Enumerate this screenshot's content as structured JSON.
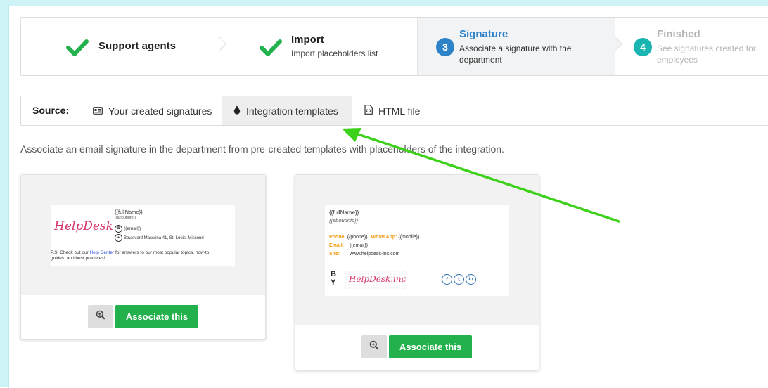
{
  "steps": [
    {
      "title": "Support agents",
      "subtitle": "",
      "state": "done"
    },
    {
      "title": "Import",
      "subtitle": "Import placeholders list",
      "state": "done"
    },
    {
      "title": "Signature",
      "subtitle_line1": "Associate a signature with the",
      "subtitle_line2": "department",
      "number": "3",
      "state": "active"
    },
    {
      "title": "Finished",
      "subtitle_line1": "See signatures created for",
      "subtitle_line2": "employees",
      "number": "4",
      "state": "pending"
    }
  ],
  "source": {
    "label": "Source:",
    "tabs": [
      {
        "label": "Your created signatures",
        "icon": "id-card-icon"
      },
      {
        "label": "Integration templates",
        "icon": "drop-icon",
        "active": true
      },
      {
        "label": "HTML file",
        "icon": "code-file-icon"
      }
    ]
  },
  "description": "Associate an email signature in the department from pre-created templates with placeholders of the integration.",
  "card1": {
    "logo": "HelpDesk",
    "full_name": "{{fullName}}",
    "about": "{{aboutInfo}}",
    "email": "{{email}}",
    "address": "Boulevard Masséna 41, St. Louis, Missouri",
    "ps_prefix": "P.S. Check out our ",
    "ps_link": "Help Center",
    "ps_suffix": " for answers to our most popular topics, how-to",
    "ps_line2": "guides, and best practices!",
    "button": "Associate this"
  },
  "card2": {
    "full_name": "{{fullName}}",
    "about": "{{aboutInfo}}",
    "phone_label": "Phone:",
    "phone": "{{phone}}",
    "whatsapp_label": "WhatsApp:",
    "mobile": "{{mobile}}",
    "email_label": "Email:",
    "email": "{{email}}",
    "site_label": "Site:",
    "site": "www.helpdesk-inc.com",
    "by": "BY",
    "logo": "HelpDesk.inc",
    "socials": [
      "f",
      "t",
      "in"
    ],
    "button": "Associate this"
  },
  "colors": {
    "check": "#22b14c",
    "step3": "#2d82c8",
    "step4": "#1ab5b0",
    "button": "#22b14c",
    "arrow": "#3dd11b"
  }
}
